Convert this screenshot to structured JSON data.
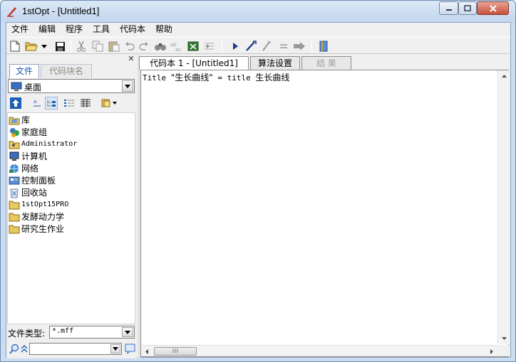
{
  "window": {
    "title": "1stOpt - [Untitled1]",
    "controls": {
      "minimize": "–",
      "maximize": "□",
      "close": "✕"
    }
  },
  "menu": [
    "文件",
    "编辑",
    "程序",
    "工具",
    "代码本",
    "帮助"
  ],
  "toolbar": {
    "icons": [
      "new-file-icon",
      "open-folder-icon",
      "open-dropdown-icon",
      "save-icon",
      "cut-icon",
      "copy-icon",
      "paste-icon",
      "undo-icon",
      "redo-icon",
      "find-icon",
      "replace-icon",
      "export-icon",
      "import-icon",
      "run-icon",
      "compile-icon",
      "step-icon",
      "equals-icon",
      "forward-icon",
      "book-icon"
    ]
  },
  "left_panel": {
    "close_glyph": "✕",
    "tabs": [
      "文件",
      "代码块名"
    ],
    "location": "桌面",
    "tree": [
      {
        "label": "库",
        "icon": "library-icon"
      },
      {
        "label": "家庭组",
        "icon": "homegroup-icon"
      },
      {
        "label": "Administrator",
        "icon": "user-folder-icon"
      },
      {
        "label": "计算机",
        "icon": "computer-icon"
      },
      {
        "label": "网络",
        "icon": "network-icon"
      },
      {
        "label": "控制面板",
        "icon": "control-panel-icon"
      },
      {
        "label": "回收站",
        "icon": "recycle-bin-icon"
      },
      {
        "label": "1stOpt15PRO",
        "icon": "folder-icon"
      },
      {
        "label": "发酵动力学",
        "icon": "folder-icon"
      },
      {
        "label": "研究生作业",
        "icon": "folder-icon"
      }
    ],
    "filetype_label": "文件类型:",
    "filetype_value": "*.mff",
    "search_value": ""
  },
  "editor": {
    "tabs": [
      "代码本 1 - [Untitled1]",
      "算法设置",
      "结 果"
    ],
    "code_prefix": "Title ",
    "code_quoted": "\"生长曲线\"",
    "code_mid": " = title ",
    "code_tail": "生长曲线"
  },
  "colors": {
    "accent_tab": "#1a58b0",
    "frame": "#c9dcf2"
  }
}
